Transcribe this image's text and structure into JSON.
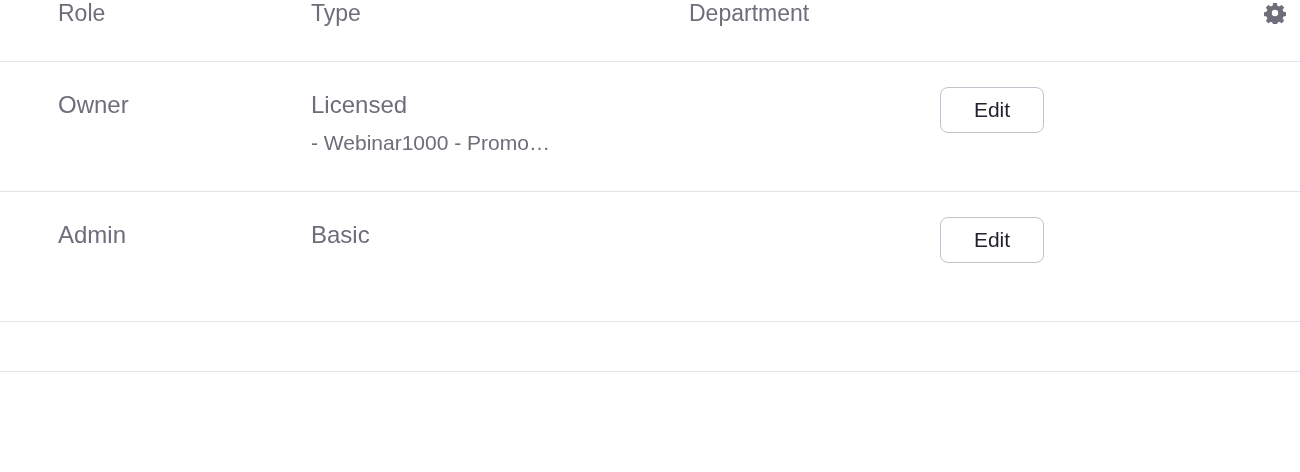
{
  "table": {
    "columns": [
      "Role",
      "Type",
      "Department"
    ],
    "rows": [
      {
        "role": "Owner",
        "type": "Licensed",
        "type_detail": "- Webinar1000 - Promo…",
        "action": "Edit"
      },
      {
        "role": "Admin",
        "type": "Basic",
        "action": "Edit"
      }
    ]
  }
}
